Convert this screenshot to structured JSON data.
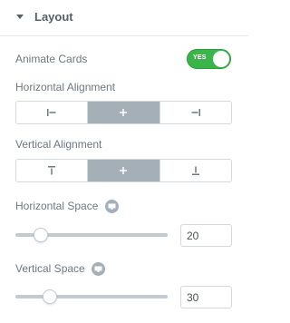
{
  "section": {
    "title": "Layout"
  },
  "animate_cards": {
    "label": "Animate Cards",
    "toggle_text": "YES",
    "enabled": true
  },
  "horizontal_alignment": {
    "label": "Horizontal Alignment",
    "options": [
      "align-left-icon",
      "align-center-icon",
      "align-right-icon"
    ],
    "selected": 1
  },
  "vertical_alignment": {
    "label": "Vertical Alignment",
    "options": [
      "align-top-icon",
      "align-middle-icon",
      "align-bottom-icon"
    ],
    "selected": 1
  },
  "horizontal_space": {
    "label": "Horizontal Space",
    "icon": "desktop-icon",
    "value": "20",
    "fraction": 0.14
  },
  "vertical_space": {
    "label": "Vertical Space",
    "icon": "desktop-icon",
    "value": "30",
    "fraction": 0.2
  },
  "colors": {
    "toggle_on": "#39b54a",
    "segment_active": "#a4afb7",
    "text": "#6d7882"
  }
}
